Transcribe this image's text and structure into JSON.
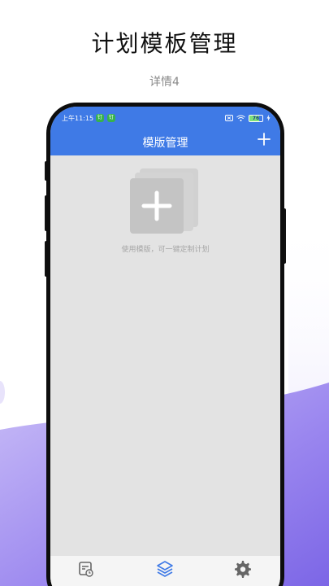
{
  "header": {
    "title": "计划模板管理",
    "subtitle": "详情4"
  },
  "status_bar": {
    "time": "上午11:15",
    "badge_1": "钉",
    "badge_2": "钉",
    "battery": "76"
  },
  "app_bar": {
    "title": "模版管理",
    "add_icon": "plus-icon"
  },
  "empty_state": {
    "icon": "add-template-icon",
    "message": "使用模版，可一键定制计划"
  },
  "tab_bar": {
    "tabs": [
      {
        "icon": "calendar-clock-icon",
        "active": false
      },
      {
        "icon": "layers-icon",
        "active": true
      },
      {
        "icon": "gear-icon",
        "active": false
      }
    ]
  },
  "colors": {
    "accent": "#3f7ae6",
    "empty_background": "#e3e3e3",
    "empty_icon": "#cbcbcb",
    "wave": "#9d88f0"
  }
}
